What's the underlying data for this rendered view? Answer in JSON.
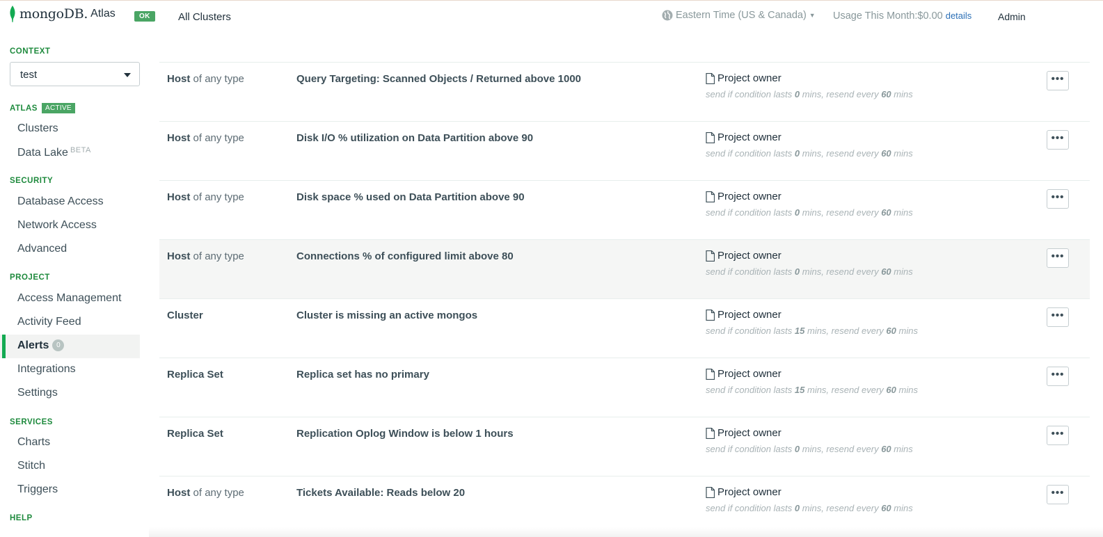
{
  "topbar": {
    "brand": "mongoDB.",
    "brand_product": "Atlas",
    "status_badge": "OK",
    "cluster_selector": "All Clusters",
    "timezone": "Eastern Time (US & Canada)",
    "usage_label": "Usage This Month:$0.00",
    "usage_link": "details",
    "user": "Admin"
  },
  "sidebar": {
    "context": {
      "header": "CONTEXT",
      "value": "test"
    },
    "atlas": {
      "header": "ATLAS",
      "badge": "ACTIVE",
      "items": [
        {
          "label": "Clusters"
        },
        {
          "label": "Data Lake",
          "tag": "BETA"
        }
      ]
    },
    "security": {
      "header": "SECURITY",
      "items": [
        {
          "label": "Database Access"
        },
        {
          "label": "Network Access"
        },
        {
          "label": "Advanced"
        }
      ]
    },
    "project": {
      "header": "PROJECT",
      "items": [
        {
          "label": "Access Management"
        },
        {
          "label": "Activity Feed"
        },
        {
          "label": "Alerts",
          "count": "0"
        },
        {
          "label": "Integrations"
        },
        {
          "label": "Settings"
        }
      ]
    },
    "services": {
      "header": "SERVICES",
      "items": [
        {
          "label": "Charts"
        },
        {
          "label": "Stitch"
        },
        {
          "label": "Triggers"
        }
      ]
    },
    "help": {
      "header": "HELP"
    }
  },
  "alerts": [
    {
      "target": "Host",
      "target_suffix": " of any type",
      "condition": "Query Targeting: Scanned Objects / Returned above 1000",
      "recipient": "Project owner",
      "rule_a": "send if condition lasts ",
      "lasts": "0",
      "rule_b": " mins, resend every ",
      "resend": "60",
      "rule_c": " mins"
    },
    {
      "target": "Host",
      "target_suffix": " of any type",
      "condition": "Disk I/O % utilization on Data Partition above 90",
      "recipient": "Project owner",
      "rule_a": "send if condition lasts ",
      "lasts": "0",
      "rule_b": " mins, resend every ",
      "resend": "60",
      "rule_c": " mins"
    },
    {
      "target": "Host",
      "target_suffix": " of any type",
      "condition": "Disk space % used on Data Partition above 90",
      "recipient": "Project owner",
      "rule_a": "send if condition lasts ",
      "lasts": "0",
      "rule_b": " mins, resend every ",
      "resend": "60",
      "rule_c": " mins"
    },
    {
      "target": "Host",
      "target_suffix": " of any type",
      "condition": "Connections % of configured limit above 80",
      "recipient": "Project owner",
      "rule_a": "send if condition lasts ",
      "lasts": "0",
      "rule_b": " mins, resend every ",
      "resend": "60",
      "rule_c": " mins"
    },
    {
      "target": "Cluster",
      "target_suffix": "",
      "condition": "Cluster is missing an active mongos",
      "recipient": "Project owner",
      "rule_a": "send if condition lasts ",
      "lasts": "15",
      "rule_b": " mins, resend every ",
      "resend": "60",
      "rule_c": " mins"
    },
    {
      "target": "Replica Set",
      "target_suffix": "",
      "condition": "Replica set has no primary",
      "recipient": "Project owner",
      "rule_a": "send if condition lasts ",
      "lasts": "15",
      "rule_b": " mins, resend every ",
      "resend": "60",
      "rule_c": " mins"
    },
    {
      "target": "Replica Set",
      "target_suffix": "",
      "condition": "Replication Oplog Window is below 1 hours",
      "recipient": "Project owner",
      "rule_a": "send if condition lasts ",
      "lasts": "0",
      "rule_b": " mins, resend every ",
      "resend": "60",
      "rule_c": " mins"
    },
    {
      "target": "Host",
      "target_suffix": " of any type",
      "condition": "Tickets Available: Reads below 20",
      "recipient": "Project owner",
      "rule_a": "send if condition lasts ",
      "lasts": "0",
      "rule_b": " mins, resend every ",
      "resend": "60",
      "rule_c": " mins"
    }
  ],
  "more_button": "•••",
  "colors": {
    "accent": "#13aa52",
    "badge": "#4aa564",
    "link": "#2b6fb6"
  }
}
